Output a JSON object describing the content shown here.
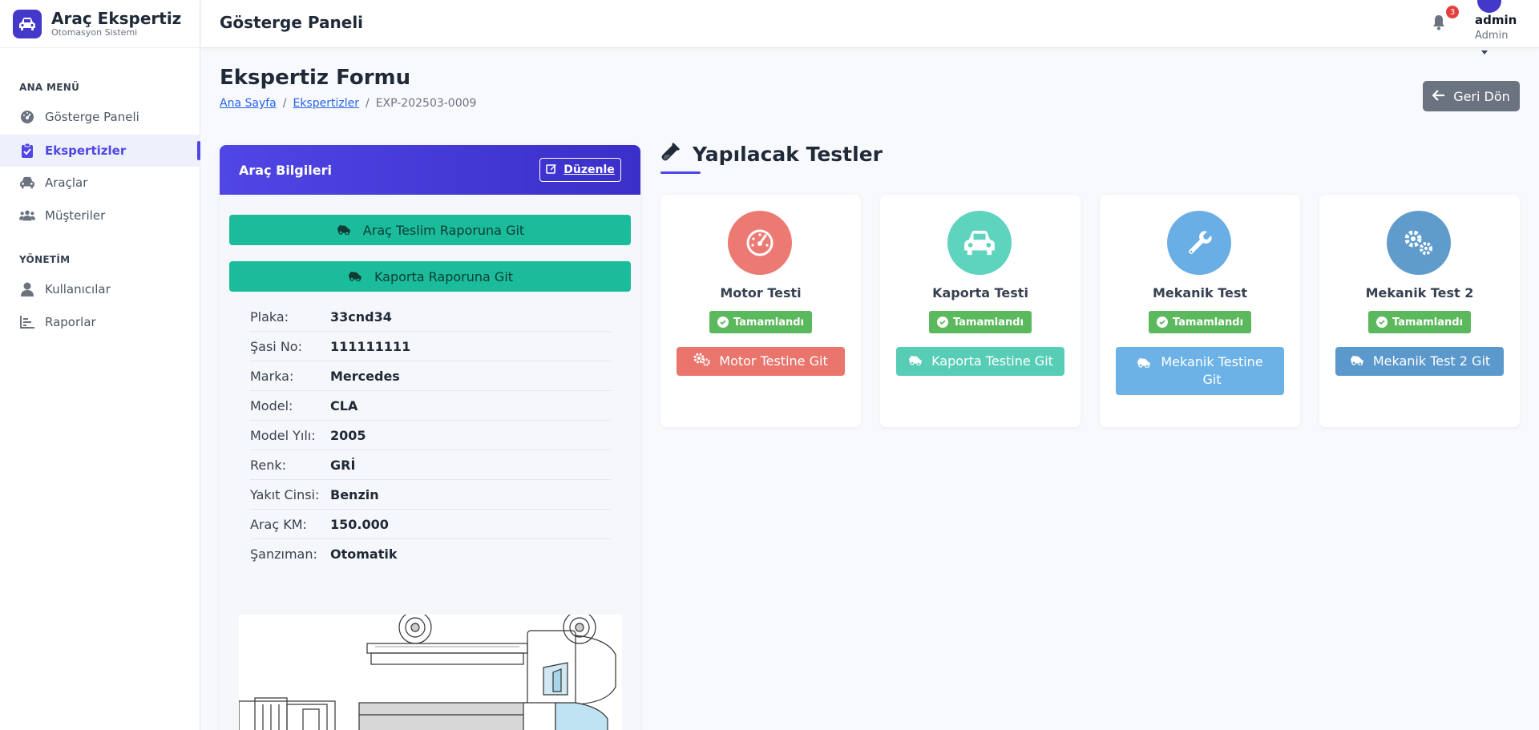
{
  "brand": {
    "title": "Araç Ekspertiz",
    "subtitle": "Otomasyon Sistemi"
  },
  "sidebar": {
    "section_main": "ANA MENÜ",
    "section_admin": "YÖNETİM",
    "items": [
      {
        "label": "Gösterge Paneli",
        "icon": "dashboard-icon"
      },
      {
        "label": "Ekspertizler",
        "icon": "clipboard-check-icon",
        "active": true
      },
      {
        "label": "Araçlar",
        "icon": "car-icon"
      },
      {
        "label": "Müşteriler",
        "icon": "users-icon"
      },
      {
        "label": "Kullanıcılar",
        "icon": "user-icon"
      },
      {
        "label": "Raporlar",
        "icon": "chart-bar-icon"
      }
    ]
  },
  "topbar": {
    "title": "Gösterge Paneli",
    "notification_count": "3",
    "user_name": "admin",
    "user_role": "Admin"
  },
  "page": {
    "title": "Ekspertiz Formu",
    "breadcrumb": [
      "Ana Sayfa",
      "Ekspertizler",
      "EXP-202503-0009"
    ],
    "back_label": "Geri Dön"
  },
  "vehicle": {
    "title": "Araç Bilgileri",
    "edit_label": "Düzenle",
    "btn_delivery": "Araç Teslim Raporuna Git",
    "btn_body": "Kaporta Raporuna Git",
    "fields": [
      {
        "label": "Plaka:",
        "value": "33cnd34"
      },
      {
        "label": "Şasi No:",
        "value": "111111111"
      },
      {
        "label": "Marka:",
        "value": "Mercedes"
      },
      {
        "label": "Model:",
        "value": "CLA"
      },
      {
        "label": "Model Yılı:",
        "value": "2005"
      },
      {
        "label": "Renk:",
        "value": "GRİ"
      },
      {
        "label": "Yakıt Cinsi:",
        "value": "Benzin"
      },
      {
        "label": "Araç KM:",
        "value": "150.000"
      },
      {
        "label": "Şanzıman:",
        "value": "Otomatik"
      }
    ]
  },
  "tests": {
    "title": "Yapılacak Testler",
    "items": [
      {
        "name": "Motor Testi",
        "status": "Tamamlandı",
        "button": "Motor Testine Git",
        "color": "#ec7a72",
        "btn_color": "#e9756d",
        "icon": "tachometer-icon"
      },
      {
        "name": "Kaporta Testi",
        "status": "Tamamlandı",
        "button": "Kaporta Testine Git",
        "color": "#5ed3bd",
        "btn_color": "#58cdb6",
        "icon": "car-icon"
      },
      {
        "name": "Mekanik Test",
        "status": "Tamamlandı",
        "button": "Mekanik Testine Git",
        "color": "#6aaee6",
        "btn_color": "#6cb2e6",
        "icon": "wrench-icon"
      },
      {
        "name": "Mekanik Test 2",
        "status": "Tamamlandı",
        "button": "Mekanik Test 2 Git",
        "color": "#5f9ccc",
        "btn_color": "#5b98cb",
        "icon": "cogs-icon"
      }
    ]
  }
}
